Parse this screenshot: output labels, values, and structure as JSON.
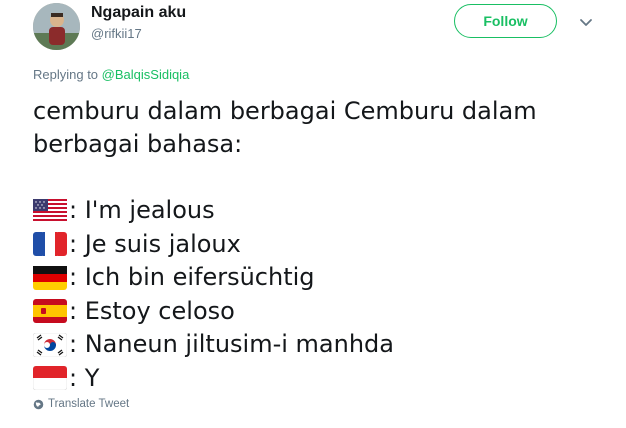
{
  "tweet": {
    "author_name": "Ngapain aku",
    "handle": "@rifkii17",
    "follow_label": "Follow",
    "replying_prefix": "Replying to",
    "replying_to": "@BalqisSidiqia",
    "text_intro": "cemburu dalam berbagai Cemburu dalam berbagai bahasa:",
    "lines": [
      {
        "flag": "us-flag-icon",
        "text": ": I'm jealous"
      },
      {
        "flag": "france-flag-icon",
        "text": ": Je suis jaloux"
      },
      {
        "flag": "germany-flag-icon",
        "text": ": Ich bin eifersüchtig"
      },
      {
        "flag": "spain-flag-icon",
        "text": ": Estoy celoso"
      },
      {
        "flag": "south-korea-flag-icon",
        "text": ": Naneun jiltusim-i manhda"
      },
      {
        "flag": "indonesia-flag-icon",
        "text": ": Y"
      }
    ],
    "translate_label": "Translate Tweet"
  },
  "colors": {
    "accent": "#19bf63",
    "text": "#14171a",
    "muted": "#657786"
  }
}
